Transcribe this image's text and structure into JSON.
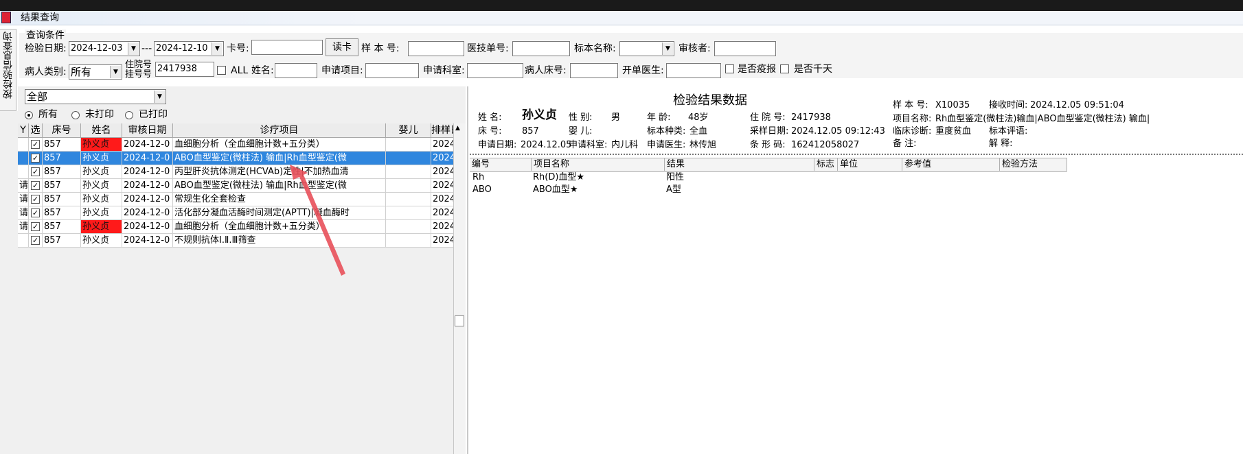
{
  "window": {
    "title": "结果查询"
  },
  "side_tab": {
    "label": "按检验信息查询"
  },
  "query": {
    "legend": "查询条件",
    "date_label": "检验日期:",
    "date_from": "2024-12-03",
    "date_sep": "---",
    "date_to": "2024-12-10",
    "card_label": "卡号:",
    "card_value": "",
    "read_card_button": "读卡",
    "sample_no_label": "样 本 号:",
    "sample_no_value": "",
    "tech_no_label": "医技单号:",
    "tech_no_value": "",
    "specimen_label": "标本名称:",
    "specimen_value": "",
    "reviewer_label": "审核者:",
    "reviewer_value": "",
    "patient_type_label": "病人类别:",
    "patient_type_value": "所有",
    "inpatient_label_1": "住院号",
    "inpatient_label_2": "挂号号",
    "inpatient_value": "2417938",
    "all_checkbox_label": "ALL",
    "name_label": "姓名:",
    "name_value": "",
    "apply_item_label": "申请项目:",
    "apply_item_value": "",
    "apply_dept_label": "申请科室:",
    "apply_dept_value": "",
    "bed_label": "病人床号:",
    "bed_value": "",
    "doctor_label": "开单医生:",
    "doctor_value": "",
    "epidemic_label": "是否疫报",
    "dry_label": "是否千天"
  },
  "filter": {
    "combo_value": "全部",
    "radios": [
      {
        "label": "所有",
        "checked": true
      },
      {
        "label": "未打印",
        "checked": false
      },
      {
        "label": "已打印",
        "checked": false
      }
    ]
  },
  "grid": {
    "columns": [
      "Y",
      "选",
      "床号",
      "姓名",
      "审核日期",
      "诊疗项目",
      "婴儿",
      "排样日"
    ],
    "rows": [
      {
        "flag": "",
        "checked": true,
        "bed": "857",
        "name": "孙义贞",
        "name_red": true,
        "date": "2024-12-0",
        "item": "血细胞分析（全血细胞计数+五分类）",
        "baby": "",
        "sort": "2024-1",
        "selected": false
      },
      {
        "flag": "",
        "checked": true,
        "bed": "857",
        "name": "孙义贞",
        "name_red": false,
        "date": "2024-12-0",
        "item": "ABO血型鉴定(微柱法) 输血|Rh血型鉴定(微",
        "baby": "",
        "sort": "2024-1",
        "selected": true
      },
      {
        "flag": "",
        "checked": true,
        "bed": "857",
        "name": "孙义贞",
        "name_red": false,
        "date": "2024-12-0",
        "item": "丙型肝炎抗体测定(HCVAb)定性|不加热血清",
        "baby": "",
        "sort": "2024-1",
        "selected": false
      },
      {
        "flag": "请",
        "checked": true,
        "bed": "857",
        "name": "孙义贞",
        "name_red": false,
        "date": "2024-12-0",
        "item": "ABO血型鉴定(微柱法) 输血|Rh血型鉴定(微",
        "baby": "",
        "sort": "2024-1",
        "selected": false
      },
      {
        "flag": "请",
        "checked": true,
        "bed": "857",
        "name": "孙义贞",
        "name_red": false,
        "date": "2024-12-0",
        "item": "常规生化全套检查",
        "baby": "",
        "sort": "2024-1",
        "selected": false
      },
      {
        "flag": "请",
        "checked": true,
        "bed": "857",
        "name": "孙义贞",
        "name_red": false,
        "date": "2024-12-0",
        "item": "活化部分凝血活酶时间测定(APTT)|凝血酶时",
        "baby": "",
        "sort": "2024-1",
        "selected": false
      },
      {
        "flag": "请",
        "checked": true,
        "bed": "857",
        "name": "孙义贞",
        "name_red": true,
        "date": "2024-12-0",
        "item": "血细胞分析（全血细胞计数+五分类）",
        "baby": "",
        "sort": "2024-1",
        "selected": false
      },
      {
        "flag": "",
        "checked": true,
        "bed": "857",
        "name": "孙义贞",
        "name_red": false,
        "date": "2024-12-0",
        "item": "不规则抗体Ⅰ.Ⅱ.Ⅲ筛查",
        "baby": "",
        "sort": "2024-1",
        "selected": false
      }
    ]
  },
  "detail": {
    "title": "检验结果数据",
    "name_label": "姓     名:",
    "name_value": "孙义贞",
    "sex_label": "性     别:",
    "sex_value": "男",
    "age_label": "年     龄:",
    "age_value": "48岁",
    "inpatient_label": "住 院 号:",
    "inpatient_value": "2417938",
    "bed_label": "床     号:",
    "bed_value": "857",
    "baby_label": "婴     儿:",
    "baby_value": "",
    "specimen_type_label": "标本种类:",
    "specimen_type_value": "全血",
    "collect_date_label": "采样日期:",
    "collect_date_value": "2024.12.05 09:12:43",
    "apply_date_label": "申请日期:",
    "apply_date_value": "2024.12.05",
    "apply_dept_label": "申请科室:",
    "apply_dept_value": "内儿科",
    "apply_doctor_label": "申请医生:",
    "apply_doctor_value": "林传旭",
    "barcode_label": "条 形 码:",
    "barcode_value": "162412058027",
    "sample_no_label": "样 本 号:",
    "sample_no_value": "X10035",
    "receive_time_label": "接收时间:",
    "receive_time_value": "2024.12.05 09:51:04",
    "item_name_label": "项目名称:",
    "item_name_value": "Rh血型鉴定(微柱法)输血|ABO血型鉴定(微柱法) 输血|",
    "diagnosis_label": "临床诊断:",
    "diagnosis_value": "重度贫血",
    "specimen_comment_label": "标本评语:",
    "specimen_comment_value": "",
    "remark_label": "备     注:",
    "remark_value": "",
    "explain_label": "解     释:",
    "explain_value": ""
  },
  "results": {
    "columns": [
      "编号",
      "项目名称",
      "结果",
      "标志",
      "单位",
      "参考值",
      "检验方法"
    ],
    "rows": [
      {
        "code": "Rh",
        "name": "Rh(D)血型★",
        "result": "阳性",
        "flag": "",
        "unit": "",
        "ref": "",
        "method": ""
      },
      {
        "code": "ABO",
        "name": "ABO血型★",
        "result": "A型",
        "flag": "",
        "unit": "",
        "ref": "",
        "method": ""
      }
    ]
  },
  "colors": {
    "selected_row": "#2f86de",
    "highlight_name": "#ff1a1a",
    "annotation_arrow": "#e8505a"
  }
}
